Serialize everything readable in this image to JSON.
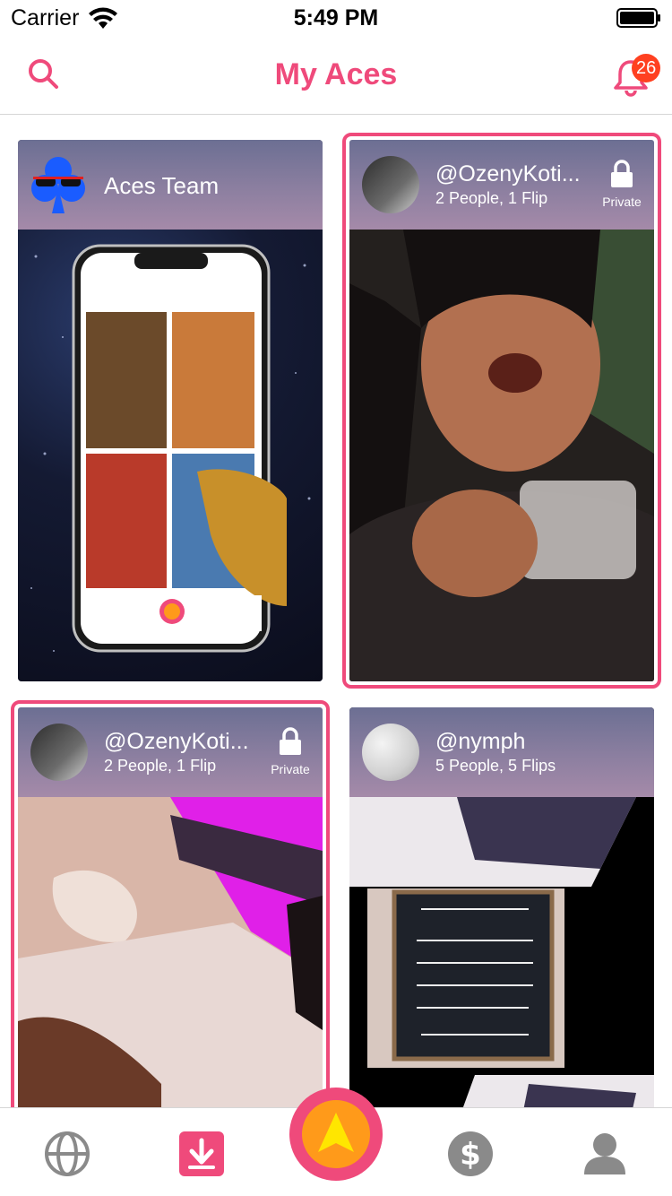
{
  "status": {
    "carrier": "Carrier",
    "time": "5:49 PM"
  },
  "nav": {
    "title": "My Aces",
    "badge_count": "26"
  },
  "cards": [
    {
      "title": "Aces Team"
    },
    {
      "title": "@OzenyKoti...",
      "subtitle": "2 People, 1 Flip",
      "privacy": "Private"
    },
    {
      "title": "@OzenyKoti...",
      "subtitle": "2 People, 1 Flip",
      "privacy": "Private"
    },
    {
      "title": "@nymph",
      "subtitle": "5 People, 5 Flips"
    }
  ],
  "tabs": {
    "items": [
      {
        "icon": "globe-icon"
      },
      {
        "icon": "download-icon",
        "active": true
      },
      {
        "icon": "aces-logo-icon"
      },
      {
        "icon": "dollar-icon"
      },
      {
        "icon": "profile-icon"
      }
    ]
  },
  "colors": {
    "accent": "#ef4a7b",
    "badge": "#ff4020",
    "center_orange": "#ff9a1a",
    "arrow_yellow": "#ffe600"
  }
}
